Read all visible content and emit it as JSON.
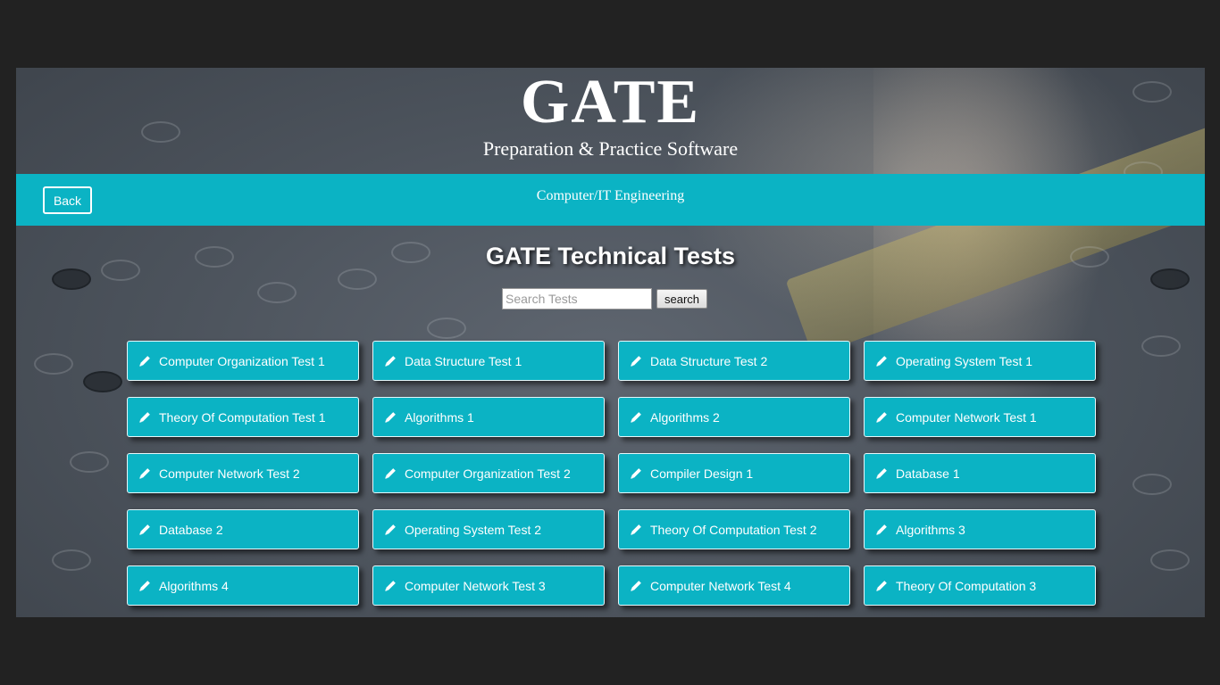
{
  "header": {
    "title": "GATE",
    "subtitle": "Preparation & Practice Software"
  },
  "nav": {
    "back_label": "Back",
    "branch": "Computer/IT Engineering"
  },
  "main": {
    "title": "GATE Technical Tests",
    "search": {
      "placeholder": "Search Tests",
      "value": "",
      "button_label": "search"
    },
    "tests": [
      {
        "label": "Computer Organization Test 1",
        "icon": "pencil-icon"
      },
      {
        "label": "Data Structure Test 1",
        "icon": "pencil-icon"
      },
      {
        "label": "Data Structure Test 2",
        "icon": "pencil-icon"
      },
      {
        "label": "Operating System Test 1",
        "icon": "pencil-icon"
      },
      {
        "label": "Theory Of Computation Test 1",
        "icon": "pencil-icon"
      },
      {
        "label": "Algorithms 1",
        "icon": "pencil-icon"
      },
      {
        "label": "Algorithms 2",
        "icon": "pencil-icon"
      },
      {
        "label": "Computer Network Test 1",
        "icon": "pencil-icon"
      },
      {
        "label": "Computer Network Test 2",
        "icon": "pencil-icon"
      },
      {
        "label": "Computer Organization Test 2",
        "icon": "pencil-icon"
      },
      {
        "label": "Compiler Design 1",
        "icon": "pencil-icon"
      },
      {
        "label": "Database 1",
        "icon": "pencil-icon"
      },
      {
        "label": "Database 2",
        "icon": "pencil-icon"
      },
      {
        "label": "Operating System Test 2",
        "icon": "pencil-icon"
      },
      {
        "label": "Theory Of Computation Test 2",
        "icon": "pencil-icon"
      },
      {
        "label": "Algorithms 3",
        "icon": "pencil-icon"
      },
      {
        "label": "Algorithms 4",
        "icon": "pencil-icon"
      },
      {
        "label": "Computer Network Test 3",
        "icon": "pencil-icon"
      },
      {
        "label": "Computer Network Test 4",
        "icon": "pencil-icon"
      },
      {
        "label": "Theory Of Computation 3",
        "icon": "pencil-icon"
      }
    ]
  },
  "colors": {
    "accent": "#0bb3c4",
    "page_background": "#222222",
    "text": "#ffffff"
  }
}
